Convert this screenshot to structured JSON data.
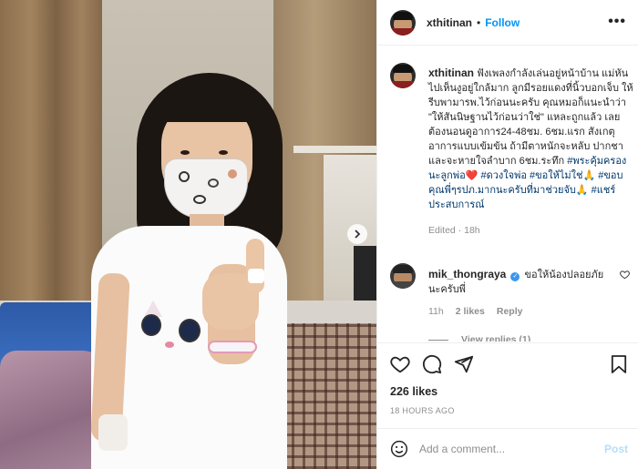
{
  "header": {
    "username": "xthitinan",
    "separator": "•",
    "follow_label": "Follow",
    "more_label": "•••"
  },
  "caption": {
    "username": "xthitinan",
    "text": "ฟังเพลงกำลังเล่นอยู่หน้าบ้าน แม่หันไปเห็นงูอยู่ใกล้มาก ลูกมีรอยแดงที่นิ้วบอกเจ็บ ให้รีบพามารพ.ไว้ก่อนนะครับ คุณหมอก็แนะนำว่า \"ให้สันนิษฐานไว้ก่อนว่าใช่\" แหละถูกแล้ว เลยต้องนอนดูอาการ24-48ชม. 6ชม.แรก สังเกตุอาการแบบเข้มข้น ถ้ามีตาหนักจะหลับ ปากชา และจะหายใจลำบาก 6ชม.ระทึก",
    "tags": [
      "#พระคุ้มครองนะลูกพ่อ❤️",
      "#ดวงใจพ่อ",
      "#ขอให้ไม่ใช่🙏",
      "#ขอบคุณพี่ๆรปภ.มากนะครับที่มาช่วยจับ🙏",
      "#แชร์ประสบการณ์"
    ],
    "edited": "Edited",
    "time": "18h"
  },
  "comment": {
    "username": "mik_thongraya",
    "verified_mark": "✓",
    "text": "ขอให้น้องปลอยภัยนะครับพี่",
    "time": "11h",
    "likes": "2 likes",
    "reply_label": "Reply",
    "view_replies": "View replies (1)"
  },
  "stats": {
    "likes": "226 likes",
    "posted": "18 HOURS AGO"
  },
  "add_comment": {
    "placeholder": "Add a comment...",
    "post_label": "Post"
  },
  "colors": {
    "accent": "#0095f6",
    "link_tag": "#00376b",
    "muted": "#8e8e8e",
    "post_disabled": "#b2dffc"
  }
}
